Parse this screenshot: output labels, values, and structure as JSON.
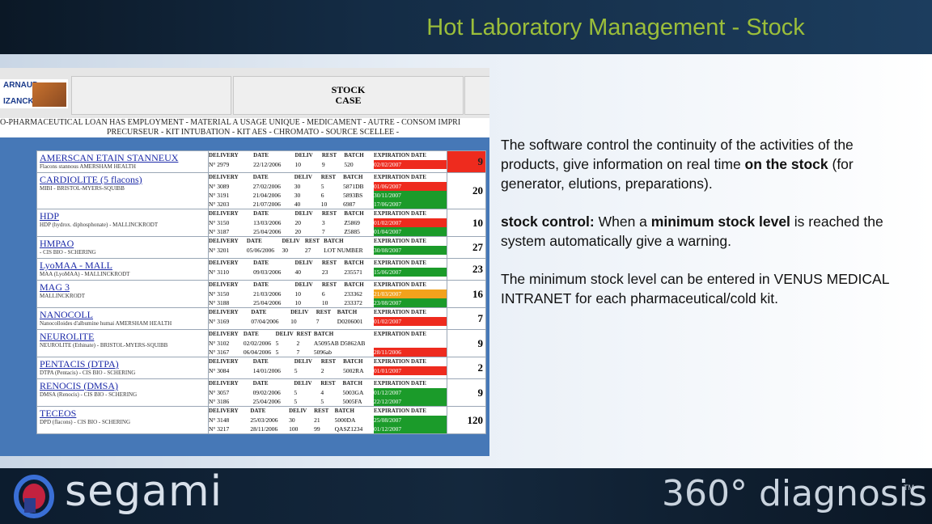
{
  "title": "Hot Laboratory Management - Stock",
  "screenshot": {
    "logo_top": "ARNAUD",
    "logo_bottom": "IZANCK",
    "stock_case_line1": "STOCK",
    "stock_case_line2": "CASE",
    "nav_line1": "O-PHARMACEUTICAL LOAN HAS EMPLOYMENT - MATERIAL A USAGE UNIQUE - MEDICAMENT - AUTRE - CONSOM IMPRI",
    "nav_line2": "PRECURSEUR - KIT INTUBATION - KIT AES - CHROMATO - SOURCE SCELLEE -",
    "products": [
      {
        "name": "AMERSCAN ETAIN STANNEUX",
        "sub": "Flacons stannous   AMERSHAM HEALTH",
        "count": "9",
        "count_color": "red",
        "headers": [
          "DELIVERY",
          "DATE",
          "DELIV",
          "REST",
          "BATCH",
          "EXPIRATION DATE"
        ],
        "rows": [
          {
            "cells": [
              "N° 2979",
              "22/12/2006",
              "10",
              "9",
              "520"
            ],
            "exp": "02/02/2007",
            "color": "red"
          }
        ]
      },
      {
        "name": "CARDIOLITE (5 flacons)",
        "sub": "MIBI - BRISTOL-MYERS-SQUIBB",
        "count": "20",
        "count_color": "",
        "headers": [
          "DELIVERY",
          "DATE",
          "DELIV",
          "REST",
          "BATCH",
          "EXPIRATION DATE"
        ],
        "rows": [
          {
            "cells": [
              "N° 3089",
              "27/02/2006",
              "30",
              "5",
              "5871DB"
            ],
            "exp": "01/06/2007",
            "color": "red"
          },
          {
            "cells": [
              "N° 3191",
              "21/04/2006",
              "30",
              "6",
              "5893BS"
            ],
            "exp": "30/11/2007",
            "color": "green"
          },
          {
            "cells": [
              "N° 3203",
              "21/07/2006",
              "40",
              "10",
              "6987"
            ],
            "exp": "17/06/2007",
            "color": "green"
          }
        ]
      },
      {
        "name": "HDP",
        "sub": "HDP (hydrox. diphosphonate) - MALLINCKRODT",
        "count": "10",
        "count_color": "",
        "headers": [
          "DELIVERY",
          "DATE",
          "DELIV",
          "REST",
          "BATCH",
          "EXPIRATION DATE"
        ],
        "rows": [
          {
            "cells": [
              "N° 3150",
              "13/03/2006",
              "20",
              "3",
              "Z5869"
            ],
            "exp": "01/02/2007",
            "color": "red"
          },
          {
            "cells": [
              "N° 3187",
              "25/04/2006",
              "20",
              "7",
              "Z5885"
            ],
            "exp": "01/04/2007",
            "color": "green"
          }
        ]
      },
      {
        "name": "HMPAO",
        "sub": "- CIS BIO - SCHERING",
        "count": "27",
        "count_color": "",
        "headers": [
          "DELIVERY",
          "DATE",
          "DELIV",
          "REST",
          "BATCH",
          "EXPIRATION DATE"
        ],
        "rows": [
          {
            "cells": [
              "N° 3201",
              "05/06/2006",
              "30",
              "27",
              "LOT NUMBER"
            ],
            "exp": "30/08/2007",
            "color": "green"
          }
        ]
      },
      {
        "name": "LyoMAA - MALL",
        "sub": "MAA (LyoMAA) - MALLINCKRODT",
        "count": "23",
        "count_color": "",
        "headers": [
          "DELIVERY",
          "DATE",
          "DELIV",
          "REST",
          "BATCH",
          "EXPIRATION DATE"
        ],
        "rows": [
          {
            "cells": [
              "N° 3110",
              "09/03/2006",
              "40",
              "23",
              "235571"
            ],
            "exp": "15/06/2007",
            "color": "green"
          }
        ]
      },
      {
        "name": "MAG 3",
        "sub": "MALLINCKRODT",
        "count": "16",
        "count_color": "",
        "headers": [
          "DELIVERY",
          "DATE",
          "DELIV",
          "REST",
          "BATCH",
          "EXPIRATION DATE"
        ],
        "rows": [
          {
            "cells": [
              "N° 3150",
              "21/03/2006",
              "10",
              "6",
              "233362"
            ],
            "exp": "21/03/2007",
            "color": "orange"
          },
          {
            "cells": [
              "N° 3188",
              "25/04/2006",
              "10",
              "10",
              "233372"
            ],
            "exp": "23/08/2007",
            "color": "green"
          }
        ]
      },
      {
        "name": "NANOCOLL",
        "sub": "Nanocolloides d'albumine humai   AMERSHAM HEALTH",
        "count": "7",
        "count_color": "",
        "headers": [
          "DELIVERY",
          "DATE",
          "DELIV",
          "REST",
          "BATCH",
          "EXPIRATION DATE"
        ],
        "rows": [
          {
            "cells": [
              "N° 3169",
              "07/04/2006",
              "10",
              "7",
              "D0206001"
            ],
            "exp": "01/02/2007",
            "color": "red"
          }
        ]
      },
      {
        "name": "NEUROLITE",
        "sub": "NEUROLITE (Ethinate) - BRISTOL-MYERS-SQUIBB",
        "count": "9",
        "count_color": "",
        "headers": [
          "DELIVERY",
          "DATE",
          "DELIV",
          "REST",
          "BATCH",
          "EXPIRATION DATE"
        ],
        "rows": [
          {
            "cells": [
              "N° 3102",
              "02/02/2006",
              "5",
              "2",
              "A5095AB D5862AB"
            ],
            "exp": "",
            "color": ""
          },
          {
            "cells": [
              "N° 3167",
              "06/04/2006",
              "5",
              "7",
              "5096ab"
            ],
            "exp": "28/11/2006",
            "color": "red"
          }
        ]
      },
      {
        "name": "PENTACIS (DTPA)",
        "sub": "DTPA (Pentacis) - CIS BIO - SCHERING",
        "count": "2",
        "count_color": "",
        "headers": [
          "DELIVERY",
          "DATE",
          "DELIV",
          "REST",
          "BATCH",
          "EXPIRATION DATE"
        ],
        "rows": [
          {
            "cells": [
              "N° 3084",
              "14/01/2006",
              "5",
              "2",
              "5002RA"
            ],
            "exp": "01/01/2007",
            "color": "red"
          }
        ]
      },
      {
        "name": "RENOCIS (DMSA)",
        "sub": "DMSA (Renocis) - CIS BIO - SCHERING",
        "count": "9",
        "count_color": "",
        "headers": [
          "DELIVERY",
          "DATE",
          "DELIV",
          "REST",
          "BATCH",
          "EXPIRATION DATE"
        ],
        "rows": [
          {
            "cells": [
              "N° 3057",
              "09/02/2006",
              "5",
              "4",
              "5003GA"
            ],
            "exp": "01/12/2007",
            "color": "green"
          },
          {
            "cells": [
              "N° 3186",
              "25/04/2006",
              "5",
              "5",
              "5005FA"
            ],
            "exp": "22/12/2007",
            "color": "green"
          }
        ]
      },
      {
        "name": "TECEOS",
        "sub": "DPD (flacons) - CIS BIO - SCHERING",
        "count": "120",
        "count_color": "",
        "headers": [
          "DELIVERY",
          "DATE",
          "DELIV",
          "REST",
          "BATCH",
          "EXPIRATION DATE"
        ],
        "rows": [
          {
            "cells": [
              "N° 3148",
              "25/03/2006",
              "30",
              "21",
              "5000DA"
            ],
            "exp": "25/08/2007",
            "color": "green"
          },
          {
            "cells": [
              "N° 3217",
              "28/11/2006",
              "100",
              "99",
              "QASZ1234"
            ],
            "exp": "01/12/2007",
            "color": "green"
          }
        ]
      }
    ]
  },
  "description": {
    "p1_pre": "The software control the continuity of the activities of the products, give information on real time ",
    "p1_bold": "on the stock",
    "p1_post": " (for generator, elutions, preparations).",
    "p2_bold1": "stock control:",
    "p2_mid": " When a ",
    "p2_bold2": "minimum stock level",
    "p2_post": " is reached the system automatically give a warning.",
    "p3": "The minimum stock level can be entered in VENUS MEDICAL INTRANET for each pharmaceutical/cold kit."
  },
  "footer": {
    "left_brand": "segami",
    "right_brand": "360° diagnosis",
    "tm": "TM"
  }
}
